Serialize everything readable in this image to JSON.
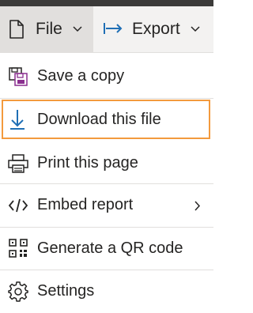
{
  "toolbar": {
    "file": {
      "label": "File",
      "icon": "document-icon"
    },
    "export": {
      "label": "Export",
      "icon": "export-arrow-icon"
    }
  },
  "menu": {
    "items": [
      {
        "label": "Save a copy",
        "icon": "save-copy-icon"
      },
      {
        "label": "Download this file",
        "icon": "download-icon",
        "highlighted": true
      },
      {
        "label": "Print this page",
        "icon": "printer-icon"
      },
      {
        "label": "Embed report",
        "icon": "code-icon",
        "has_submenu": true
      },
      {
        "label": "Generate a QR code",
        "icon": "qr-code-icon"
      },
      {
        "label": "Settings",
        "icon": "gear-icon"
      }
    ]
  },
  "colors": {
    "toolbar_bg": "#f3f2f1",
    "file_button_bg": "#e1dfdd",
    "export_icon": "#1f6fb5",
    "download_icon": "#1f6fb5",
    "save_icon_accent": "#8a2f8f",
    "highlight_border": "#f39a3d",
    "text": "#252423"
  }
}
